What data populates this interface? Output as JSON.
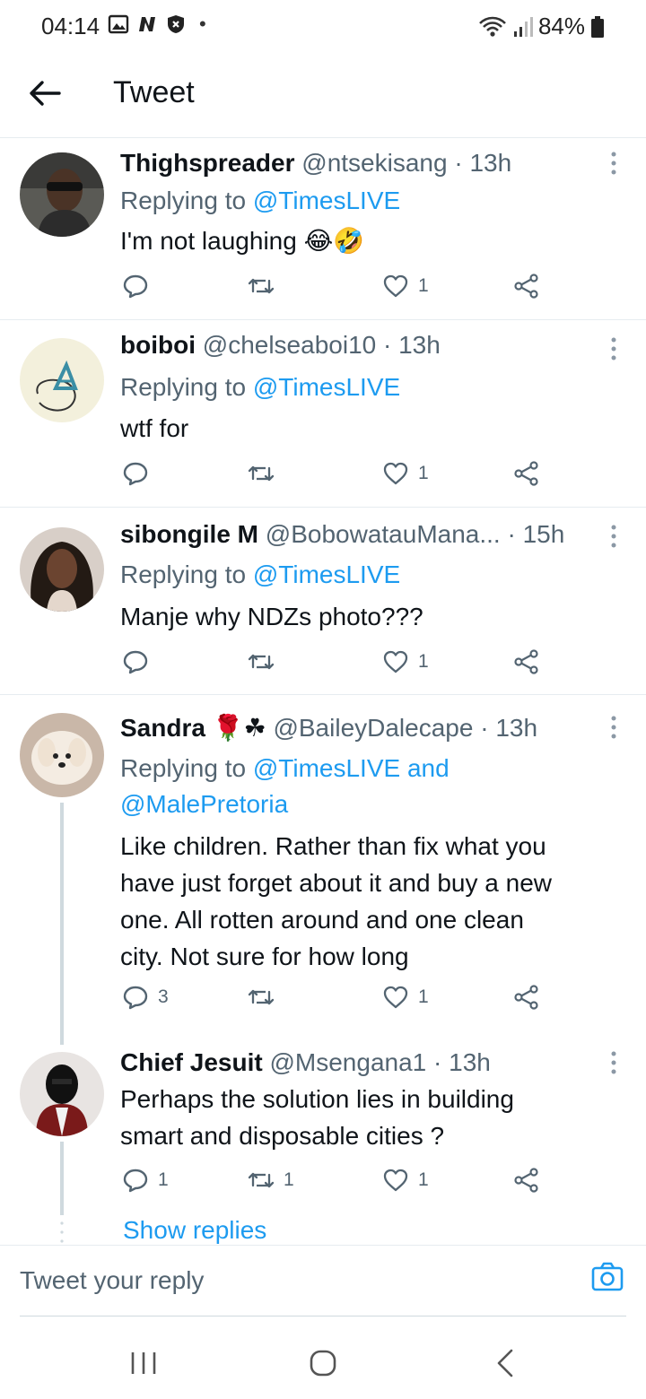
{
  "status_bar": {
    "time": "04:14",
    "battery": "84%"
  },
  "header": {
    "title": "Tweet"
  },
  "tweets": [
    {
      "name": "Thighspreader",
      "handle": "@ntsekisang",
      "time": "· 13h",
      "replying_prefix": "Replying to ",
      "replying_to": "@TimesLIVE",
      "text": "I'm not laughing 😂🤣",
      "replies": "",
      "retweets": "",
      "likes": "1"
    },
    {
      "name": "boiboi",
      "handle": "@chelseaboi10",
      "time": "· 13h",
      "replying_prefix": "Replying to ",
      "replying_to": "@TimesLIVE",
      "text": "wtf for",
      "replies": "",
      "retweets": "",
      "likes": "1"
    },
    {
      "name": "sibongile M",
      "handle": "@BobowatauMana...",
      "time": "· 15h",
      "replying_prefix": "Replying to ",
      "replying_to": "@TimesLIVE",
      "text": "Manje why NDZs photo???",
      "replies": "",
      "retweets": "",
      "likes": "1"
    },
    {
      "name": "Sandra 🌹☘",
      "handle": "@BaileyDalecape",
      "time": "· 13h",
      "replying_prefix": "Replying to ",
      "replying_to": "@TimesLIVE and",
      "replying_to_2": "@MalePretoria",
      "text_lines": [
        "Like children. Rather than fix what you",
        "have just forget about it and  buy a new",
        "one. All rotten around and one clean",
        "city. Not sure for how long"
      ],
      "replies": "3",
      "retweets": "",
      "likes": "1"
    },
    {
      "name": "Chief Jesuit",
      "handle": "@Msengana1",
      "time": "· 13h",
      "text_lines": [
        "Perhaps the solution lies in building",
        "smart and disposable cities ?"
      ],
      "replies": "1",
      "retweets": "1",
      "likes": "1"
    }
  ],
  "show_replies": "Show replies",
  "reply_bar": {
    "placeholder": "Tweet your reply"
  },
  "icons": {
    "accent": "#1d9bf0",
    "muted": "#536471"
  }
}
